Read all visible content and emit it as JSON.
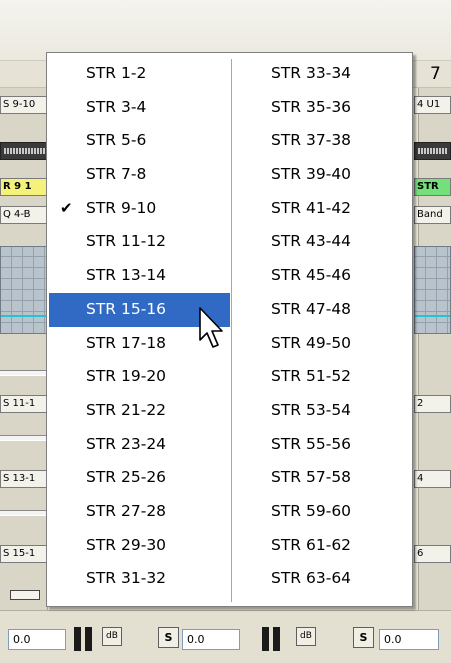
{
  "background": {
    "channel_number": "7",
    "left_strip": {
      "chips": [
        "S 9-10",
        "R 9 1",
        "Q 4-B",
        "S 11-1",
        "S 13-1",
        "S 15-1"
      ]
    },
    "right_strip": {
      "chips": [
        "4 U1",
        "STR",
        "Band",
        "2",
        "4",
        "6"
      ]
    },
    "bottom_controls": {
      "level_1": "0.0",
      "level_2": "0.0",
      "level_3": "0.0",
      "solo_label": "S",
      "db_label": "dB"
    }
  },
  "menu": {
    "checked_item": "STR 9-10",
    "highlighted_item": "STR 15-16",
    "column_1": [
      "STR 1-2",
      "STR 3-4",
      "STR 5-6",
      "STR 7-8",
      "STR 9-10",
      "STR 11-12",
      "STR 13-14",
      "STR 15-16",
      "STR 17-18",
      "STR 19-20",
      "STR 21-22",
      "STR 23-24",
      "STR 25-26",
      "STR 27-28",
      "STR 29-30",
      "STR 31-32"
    ],
    "column_2": [
      "STR 33-34",
      "STR 35-36",
      "STR 37-38",
      "STR 39-40",
      "STR 41-42",
      "STR 43-44",
      "STR 45-46",
      "STR 47-48",
      "STR 49-50",
      "STR 51-52",
      "STR 53-54",
      "STR 55-56",
      "STR 57-58",
      "STR 59-60",
      "STR 61-62",
      "STR 63-64"
    ]
  },
  "colors": {
    "menu_highlight": "#316ac5",
    "meter_line": "#24c4d4",
    "chip_yellow": "#f4f27a",
    "chip_green": "#74e07a"
  },
  "icons": {
    "check": "check-icon",
    "cursor": "arrow-cursor-icon"
  }
}
